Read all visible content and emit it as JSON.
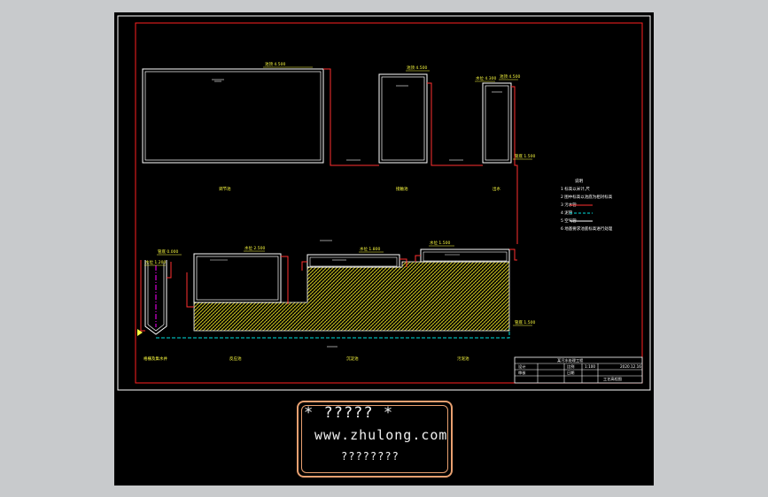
{
  "colors": {
    "background": "#c8cacc",
    "model_space": "#000000",
    "frame": "#ff2020",
    "outline": "#ffffff",
    "pipe": "#ff3030",
    "level_text": "#ffff40",
    "water_line": "#00e0e0",
    "hatch": "#d8d020",
    "axis": "#ff00ff",
    "watermark_border": "#e8a070"
  },
  "labels": {
    "tank1_top": "池顶 4.500",
    "tank2_top": "池顶 4.500",
    "tank3_top": "池顶 4.500",
    "tank3_wl": "水位 4.300",
    "pipe_end": "管底 1.500",
    "name1": "调节池",
    "name2": "接触池",
    "name3": "出水",
    "basin1_wl": "水位 2.500",
    "basin2_wl": "水位 1.800",
    "basin3_wl": "水位 1.500",
    "basin4_wl": "水位 1.200",
    "bottom_level": "管底 0.000",
    "bottom1": "格栅及集水井",
    "bottom2": "反应池",
    "bottom3": "沉淀池",
    "bottom4": "污泥池"
  },
  "legend": {
    "title": "说明",
    "items": [
      "1  标高以米计,尺",
      "2  图中标高以池底为相对标高",
      "3          污水管",
      "4          泥管",
      "5          空气管",
      "6  地基要求池底标高进行处理"
    ]
  },
  "title_block": {
    "project": "某污水处理工程",
    "drawing": "工艺高程图",
    "scale_label": "比例",
    "scale": "1:100",
    "date_label": "日期",
    "date": "2020.12.16",
    "design": "设计",
    "check": "审核"
  },
  "watermark": {
    "line1": "* ????? *",
    "line2": "www.zhulong.com",
    "line3": "????????"
  }
}
